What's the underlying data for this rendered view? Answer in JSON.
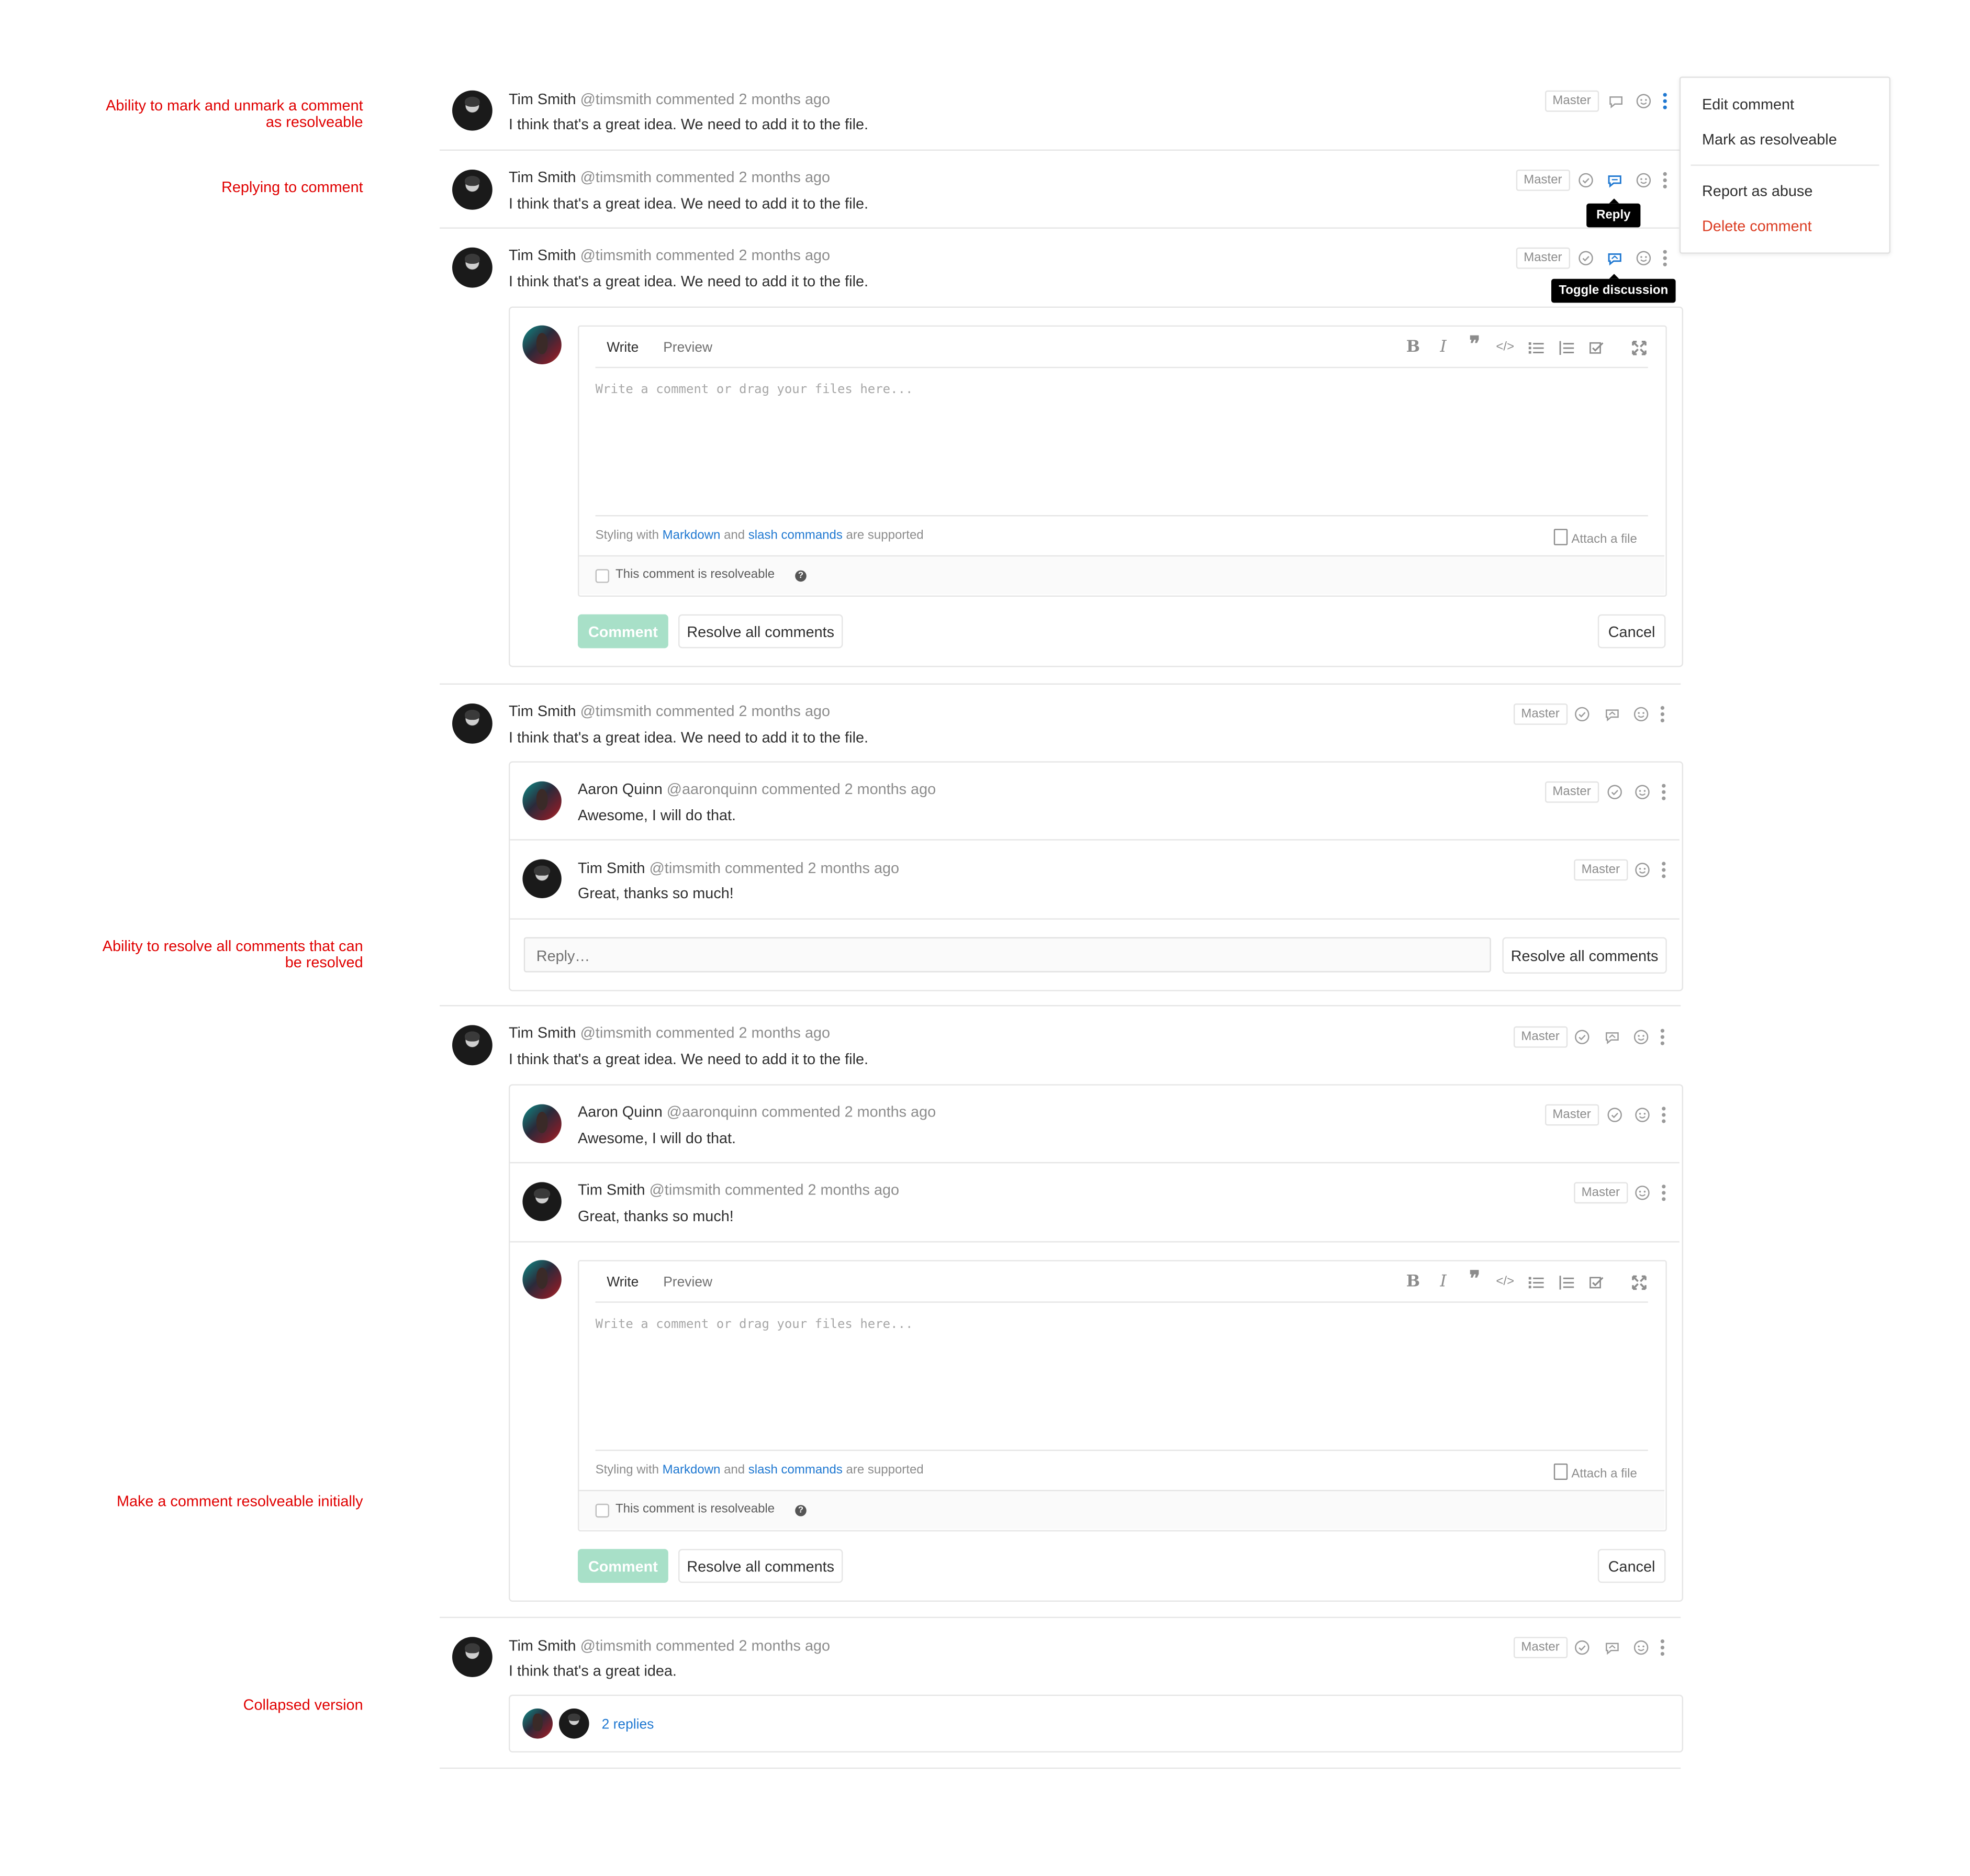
{
  "annotations": {
    "resolveable_line1": "Ability to mark and unmark a comment",
    "resolveable_line2": "as resolveable",
    "replying": "Replying to comment",
    "resolve_all_line1": "Ability to resolve all comments that can",
    "resolve_all_line2": "be resolved",
    "initially": "Make a comment resolveable initially",
    "collapsed": "Collapsed version"
  },
  "comment": {
    "tim_name": "Tim Smith",
    "tim_meta": "@timsmith commented 2 months ago",
    "aaron_name": "Aaron Quinn",
    "aaron_meta": "@aaronquinn commented 2 months ago",
    "body_idea": "I think that's a great idea. We need to add it to the file.",
    "body_idea_short": "I think that's a great idea.",
    "body_awesome": "Awesome, I will do that.",
    "body_thanks": "Great, thanks so much!",
    "badge": "Master"
  },
  "tooltips": {
    "reply": "Reply",
    "toggle": "Toggle discussion"
  },
  "menu": {
    "edit": "Edit comment",
    "mark": "Mark as resolveable",
    "report": "Report as abuse",
    "delete": "Delete comment"
  },
  "editor": {
    "tab_write": "Write",
    "tab_preview": "Preview",
    "placeholder": "Write a comment or drag your files here...",
    "hint_prefix": "Styling with",
    "hint_markdown": "Markdown",
    "hint_and": "and",
    "hint_slash": "slash commands",
    "hint_suffix": "are supported",
    "attach": "Attach a file",
    "resolveable_label": "This comment is resolveable",
    "comment_button": "Comment",
    "resolve_all_button": "Resolve all comments",
    "cancel_button": "Cancel"
  },
  "reply_input": {
    "placeholder": "Reply…"
  },
  "collapsed": {
    "replies": "2 replies"
  },
  "colors": {
    "accent": "#1f78d1",
    "annotation": "#e00000",
    "danger": "#db3b21",
    "primary_disabled": "#a8e0c8"
  }
}
